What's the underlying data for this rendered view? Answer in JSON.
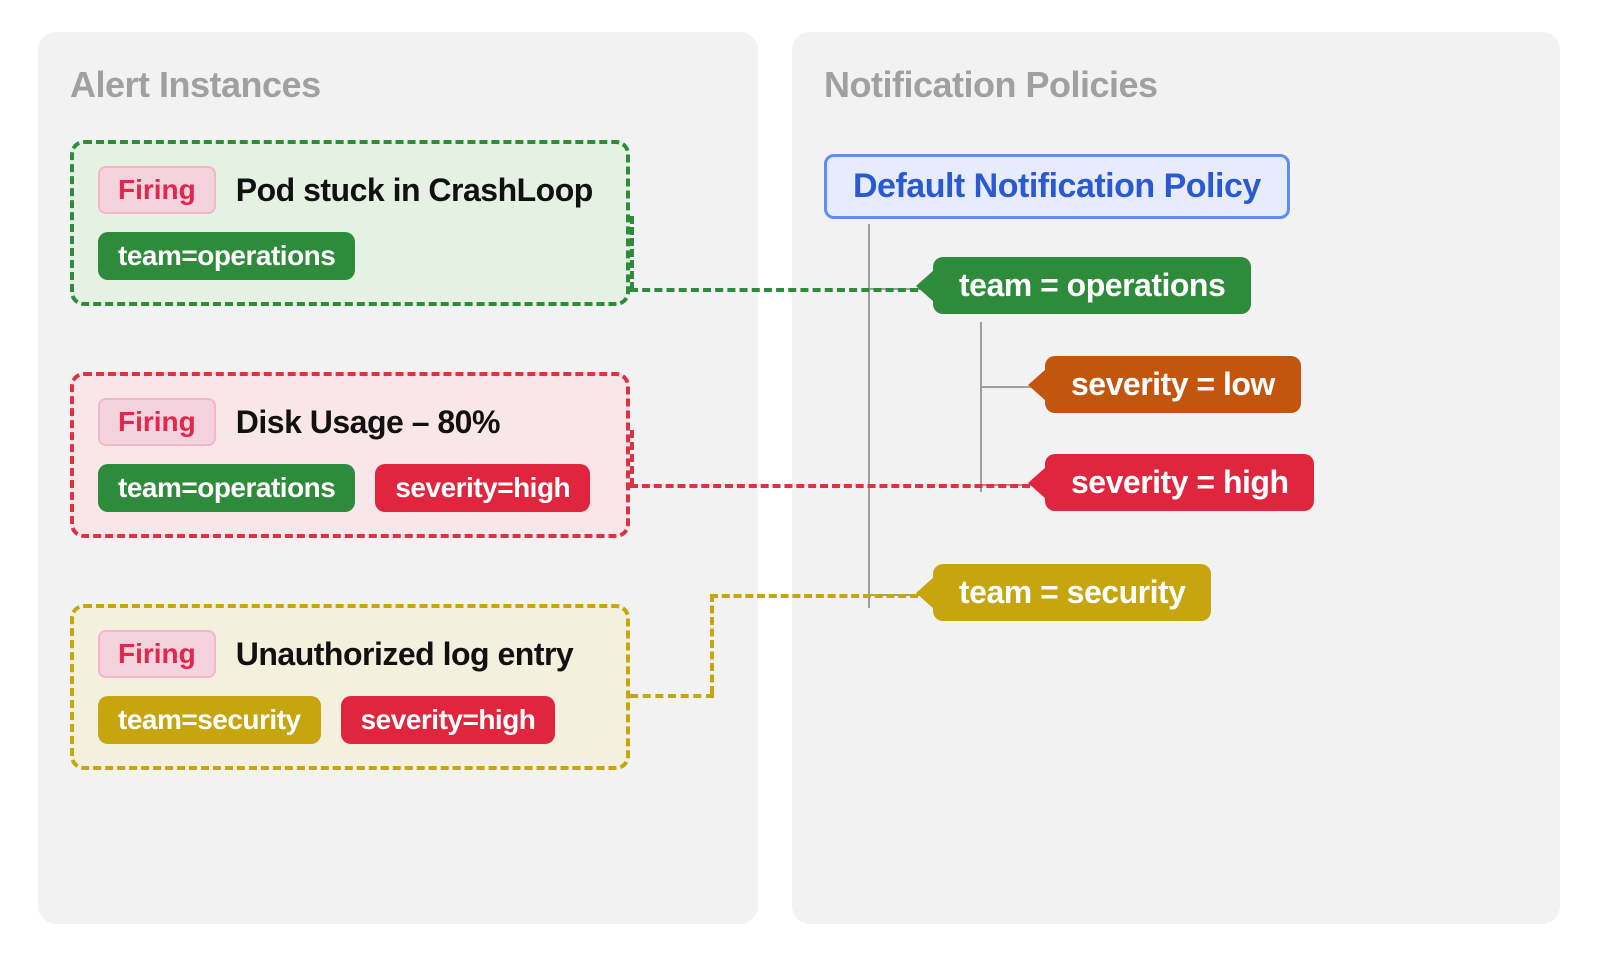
{
  "panels": {
    "left_title": "Alert Instances",
    "right_title": "Notification Policies"
  },
  "firing_label": "Firing",
  "alerts": [
    {
      "title": "Pod stuck in CrashLoop",
      "labels": [
        {
          "text": "team=operations",
          "color": "green"
        }
      ],
      "color": "green"
    },
    {
      "title": "Disk Usage – 80%",
      "labels": [
        {
          "text": "team=operations",
          "color": "green"
        },
        {
          "text": "severity=high",
          "color": "red"
        }
      ],
      "color": "red"
    },
    {
      "title": "Unauthorized log entry",
      "labels": [
        {
          "text": "team=security",
          "color": "yellow"
        },
        {
          "text": "severity=high",
          "color": "red"
        }
      ],
      "color": "yellow"
    }
  ],
  "policies": {
    "root": "Default Notification Policy",
    "nodes": [
      {
        "text": "team = operations",
        "color": "green"
      },
      {
        "text": "severity = low",
        "color": "orange"
      },
      {
        "text": "severity = high",
        "color": "red"
      },
      {
        "text": "team = security",
        "color": "yellow"
      }
    ]
  },
  "colors": {
    "green": "#2e8b3b",
    "red": "#e0253f",
    "yellow": "#c6a50f",
    "orange": "#c2560f",
    "blue": "#2a59d2",
    "panel_bg": "#f2f2f2"
  }
}
